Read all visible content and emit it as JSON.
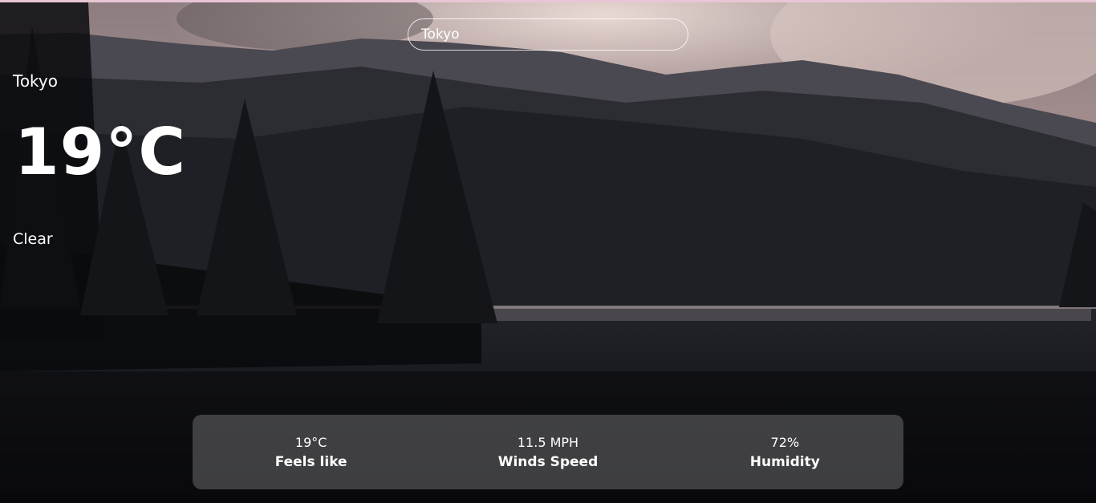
{
  "search": {
    "value": "Tokyo"
  },
  "weather": {
    "city": "Tokyo",
    "temperature": "19°C",
    "condition": "Clear"
  },
  "details": {
    "feels_like": {
      "value": "19°C",
      "label": "Feels like"
    },
    "wind_speed": {
      "value": "11.5 MPH",
      "label": "Winds Speed"
    },
    "humidity": {
      "value": "72%",
      "label": "Humidity"
    }
  }
}
